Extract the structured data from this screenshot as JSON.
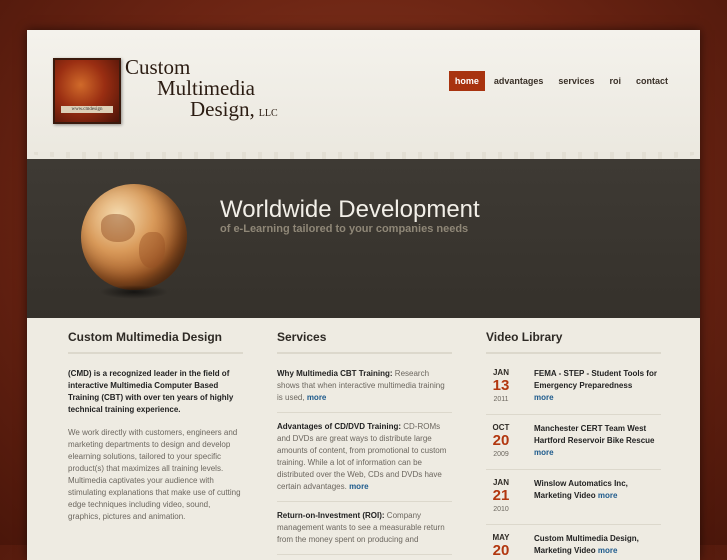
{
  "logo": {
    "line1": "Custom",
    "line2": "Multimedia",
    "line3": "Design,",
    "llc": "LLC",
    "badge_text": "www.cmdesign"
  },
  "nav": {
    "items": [
      {
        "label": "home",
        "active": true
      },
      {
        "label": "advantages",
        "active": false
      },
      {
        "label": "services",
        "active": false
      },
      {
        "label": "roi",
        "active": false
      },
      {
        "label": "contact",
        "active": false
      }
    ]
  },
  "banner": {
    "title": "Worldwide Development",
    "subtitle": "of e-Learning tailored to your companies needs"
  },
  "about": {
    "title": "Custom Multimedia Design",
    "intro_bold": "(CMD) is a recognized leader in the field of interactive Multimedia Computer Based Training (CBT) with over ten years of highly technical training experience.",
    "body": "We work directly with customers, engineers and marketing departments to design and develop elearning solutions, tailored to your specific product(s) that maximizes all training levels. Multimedia captivates your audience with stimulating explanations that make use of cutting edge techniques including video, sound, graphics, pictures and animation."
  },
  "services": {
    "title": "Services",
    "items": [
      {
        "heading": "Why Multimedia CBT Training:",
        "text": "Research shows that when interactive multimedia training is used,",
        "more": "more"
      },
      {
        "heading": "Advantages of CD/DVD Training:",
        "text": "CD-ROMs and DVDs are great ways to distribute large amounts of content, from promotional to custom training. While a lot of information can be distributed over the Web, CDs and DVDs have certain advantages.",
        "more": "more"
      },
      {
        "heading": "Return-on-Investment (ROI):",
        "text": "Company management wants to see a measurable return from the money spent on producing and",
        "more": ""
      }
    ]
  },
  "video": {
    "title": "Video Library",
    "items": [
      {
        "mon": "JAN",
        "day": "13",
        "yr": "2011",
        "title": "FEMA - STEP - Student Tools for Emergency Preparedness",
        "more": "more"
      },
      {
        "mon": "OCT",
        "day": "20",
        "yr": "2009",
        "title": "Manchester CERT Team West Hartford Reservoir Bike Rescue",
        "more": "more"
      },
      {
        "mon": "JAN",
        "day": "21",
        "yr": "2010",
        "title": "Winslow Automatics Inc, Marketing Video",
        "more": "more"
      },
      {
        "mon": "MAY",
        "day": "20",
        "yr": "",
        "title": "Custom Multimedia Design, Marketing Video",
        "more": "more"
      }
    ]
  },
  "colors": {
    "accent": "#a8330f",
    "date_red": "#b2370f",
    "link_blue": "#1d5a8c",
    "banner_bg": "#3e3a34"
  }
}
